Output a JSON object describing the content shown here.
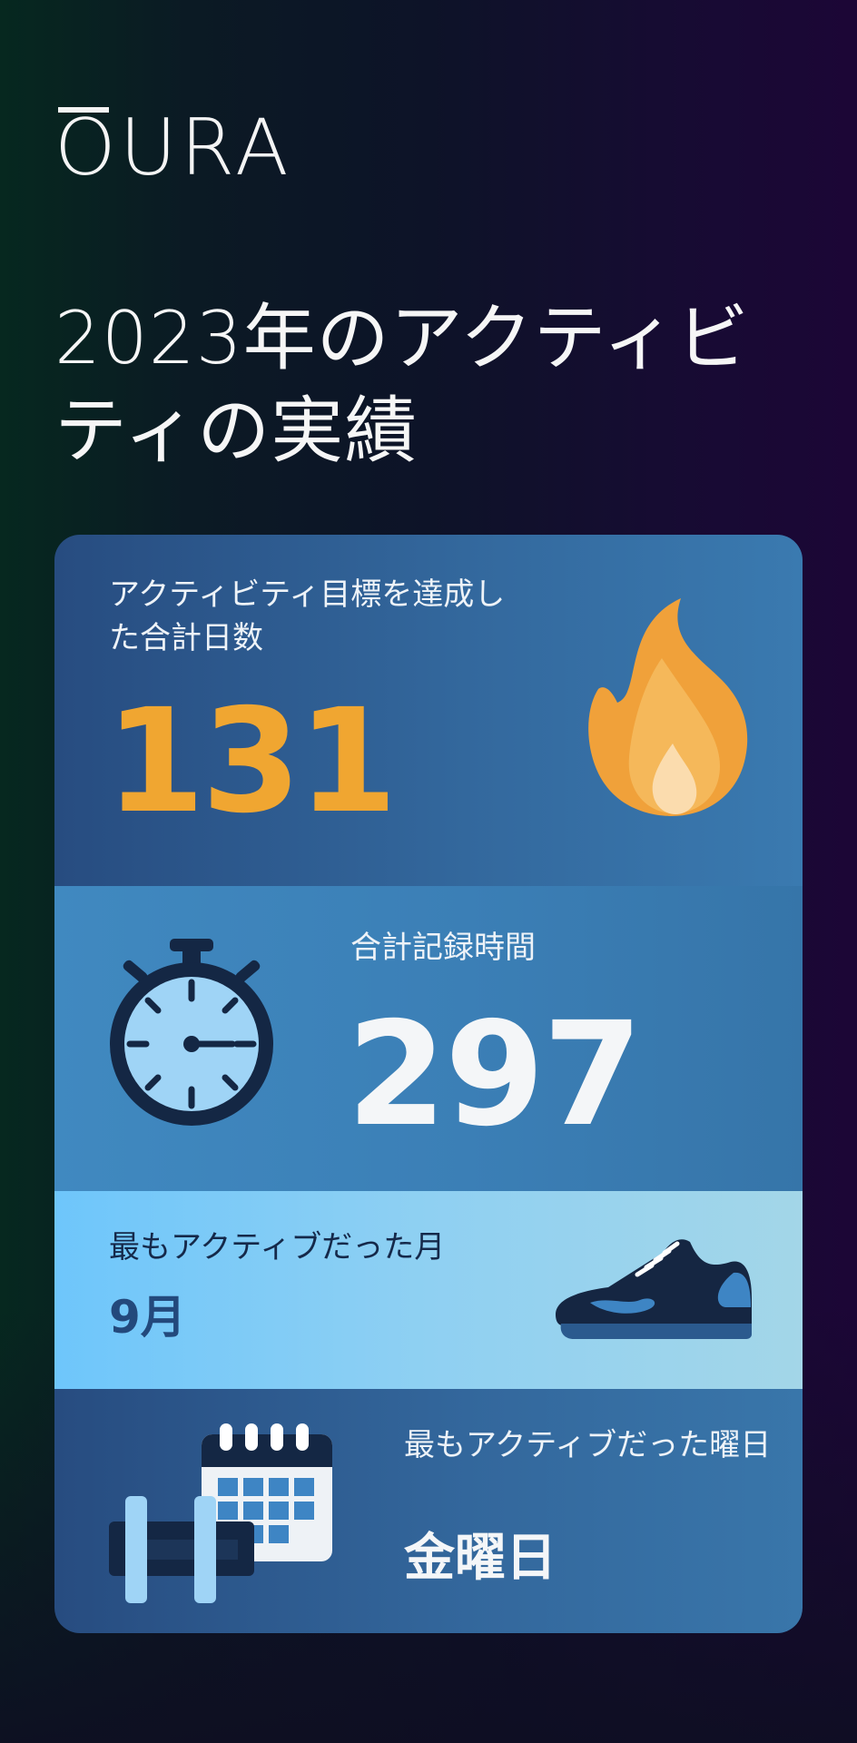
{
  "brand": {
    "logo_text": "OURA"
  },
  "headline": "2023年のアクティビティの実績",
  "stats": {
    "goal_days": {
      "label": "アクティビティ目標を達成した合計日数",
      "value": "131",
      "icon": "flame-icon"
    },
    "recorded_hours": {
      "label": "合計記録時間",
      "value": "297",
      "icon": "stopwatch-icon"
    },
    "top_month": {
      "label": "最もアクティブだった月",
      "value": "9月",
      "icon": "sneaker-icon"
    },
    "top_weekday": {
      "label": "最もアクティブだった曜日",
      "value": "金曜日",
      "icon": "dumbbell-calendar-icon"
    }
  },
  "colors": {
    "accent_orange": "#f0a631",
    "card_dark_blue": "#274c80",
    "card_light_blue": "#8fd0f2",
    "month_text": "#23497c"
  }
}
